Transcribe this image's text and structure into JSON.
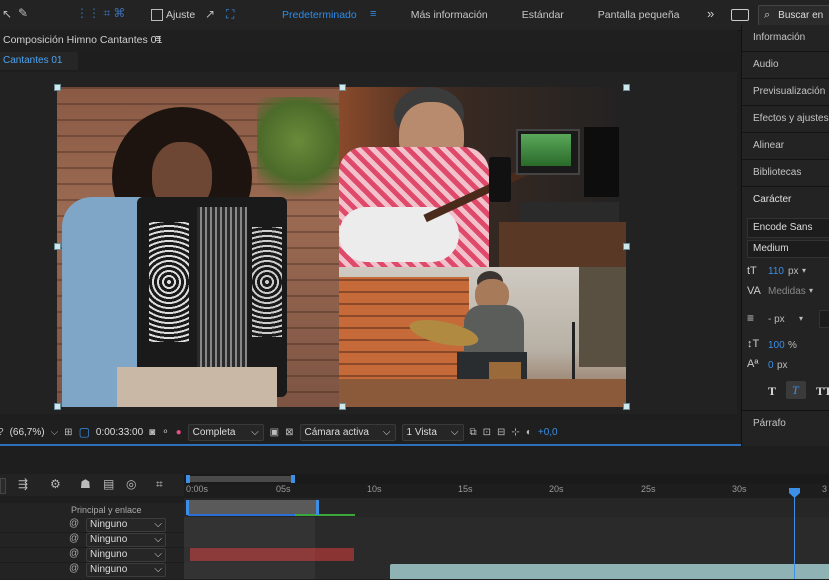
{
  "topbar": {
    "snap_label": "Ajuste",
    "workspaces": [
      {
        "label": "Predeterminado",
        "active": true
      },
      {
        "label": "Más información"
      },
      {
        "label": "Estándar"
      },
      {
        "label": "Pantalla pequeña"
      }
    ],
    "more_glyph": "»",
    "search_placeholder": "Buscar en"
  },
  "composition": {
    "panel_title": "Composición Himno Cantantes 01",
    "menu_glyph": "≡",
    "tab_label": "Cantantes 01"
  },
  "viewer_toolbar": {
    "zoom": "(66,7%)",
    "timecode": "0:00:33:00",
    "resolution": "Completa",
    "camera": "Cámara activa",
    "views": "1 Vista",
    "exposure": "+0,0"
  },
  "right_panel": {
    "items": [
      "Información",
      "Audio",
      "Previsualización",
      "Efectos y ajustes p",
      "Alinear",
      "Bibliotecas",
      "Carácter"
    ],
    "font_family": "Encode Sans",
    "font_style": "Medium",
    "font_size": "110",
    "font_size_unit": "px",
    "kerning": "Medidas",
    "stroke": "- px",
    "vertical_scale": "100",
    "vertical_scale_unit": "%",
    "baseline_shift": "0",
    "baseline_shift_unit": "px",
    "paragraph": "Párrafo"
  },
  "timeline": {
    "column_header": "Principal y enlace",
    "ruler_labels": [
      "0:00s",
      "05s",
      "10s",
      "15s",
      "20s",
      "25s",
      "30s",
      "3"
    ],
    "layers": [
      {
        "parent": "Ninguno"
      },
      {
        "parent": "Ninguno"
      },
      {
        "parent": "Ninguno"
      },
      {
        "parent": "Ninguno"
      }
    ]
  },
  "colors": {
    "accent_blue": "#2d8ceb",
    "layer_red": "#8a3434",
    "layer_teal": "#8fb3b5",
    "layer_gray": "#5a5a5a"
  }
}
